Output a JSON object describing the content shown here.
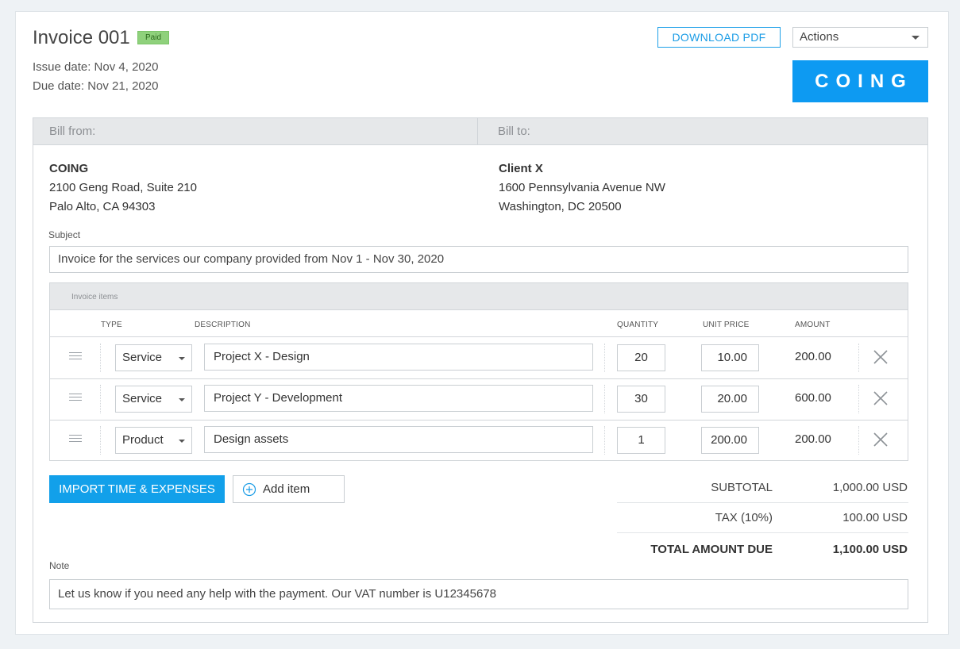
{
  "invoice": {
    "title": "Invoice 001",
    "status_badge": "Paid",
    "issue_date": "Issue date: Nov 4, 2020",
    "due_date": "Due date: Nov 21, 2020"
  },
  "toolbar": {
    "download_label": "DOWNLOAD PDF",
    "actions_value": "Actions"
  },
  "logo_text": "COING",
  "bill": {
    "from_label": "Bill from:",
    "to_label": "Bill to:",
    "from": {
      "name": "COING",
      "line1": "2100 Geng Road, Suite 210",
      "line2": "Palo Alto, CA 94303"
    },
    "to": {
      "name": "Client X",
      "line1": "1600 Pennsylvania Avenue NW",
      "line2": "Washington, DC 20500"
    }
  },
  "subject": {
    "label": "Subject",
    "value": "Invoice for the services our company provided from Nov 1 - Nov 30, 2020"
  },
  "items": {
    "header": "Invoice items",
    "columns": {
      "type": "TYPE",
      "description": "DESCRIPTION",
      "quantity": "QUANTITY",
      "unit_price": "UNIT PRICE",
      "amount": "AMOUNT"
    },
    "rows": [
      {
        "type": "Service",
        "description": "Project X - Design",
        "quantity": "20",
        "unit_price": "10.00",
        "amount": "200.00"
      },
      {
        "type": "Service",
        "description": "Project Y - Development",
        "quantity": "30",
        "unit_price": "20.00",
        "amount": "600.00"
      },
      {
        "type": "Product",
        "description": "Design assets",
        "quantity": "1",
        "unit_price": "200.00",
        "amount": "200.00"
      }
    ]
  },
  "buttons": {
    "import_label": "IMPORT TIME & EXPENSES",
    "add_item_label": "Add item"
  },
  "totals": {
    "subtotal_label": "SUBTOTAL",
    "subtotal_value": "1,000.00 USD",
    "tax_label": "TAX  (10%)",
    "tax_value": "100.00 USD",
    "total_label": "TOTAL AMOUNT DUE",
    "total_value": "1,100.00 USD"
  },
  "note": {
    "label": "Note",
    "value": "Let us know if you need any help with the payment. Our VAT number is U12345678"
  },
  "colors": {
    "accent": "#12a0ea",
    "logo_bg": "#0d9af2",
    "paid_badge": "#8fd17c",
    "header_bg": "#e6e8ea"
  },
  "icons": {
    "drag": "drag-handle-icon",
    "caret": "chevron-down-icon",
    "remove": "close-icon",
    "add": "plus-circle-icon"
  }
}
